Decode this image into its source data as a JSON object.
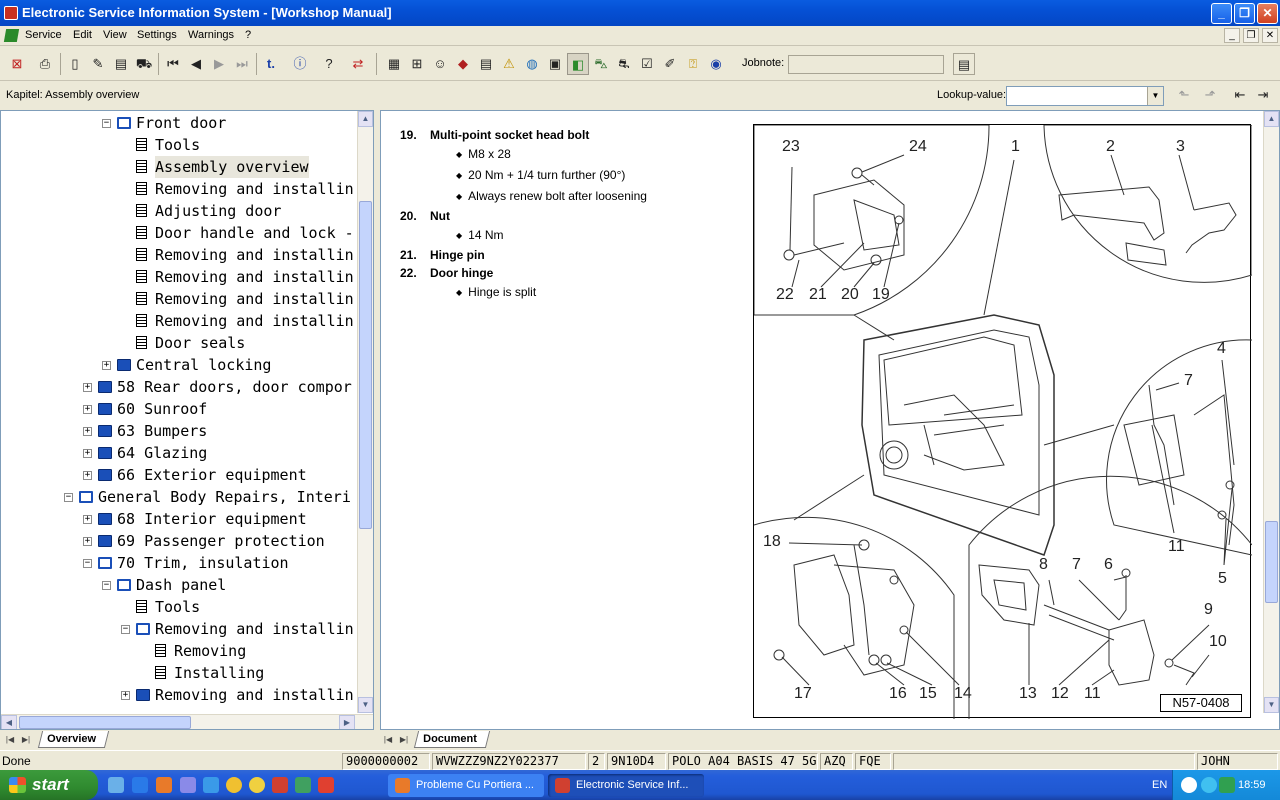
{
  "window": {
    "title": "Electronic Service Information System - [Workshop Manual]"
  },
  "menu": [
    "Service",
    "Edit",
    "View",
    "Settings",
    "Warnings",
    "?"
  ],
  "toolbar": {
    "jobnote_label": "Jobnote:",
    "jobnote_value": ""
  },
  "info": {
    "kapitel": "Kapitel: Assembly overview",
    "lookup_label": "Lookup-value:",
    "lookup_value": ""
  },
  "tree": {
    "items": [
      {
        "label": "Front door",
        "type": "book-open",
        "expander": "−",
        "level": 2
      },
      {
        "label": "Tools",
        "type": "page",
        "level": 3
      },
      {
        "label": "Assembly overview",
        "type": "page",
        "level": 3,
        "selected": true
      },
      {
        "label": "Removing and installin",
        "type": "page",
        "level": 3
      },
      {
        "label": "Adjusting door",
        "type": "page",
        "level": 3
      },
      {
        "label": "Door handle and lock -",
        "type": "page",
        "level": 3
      },
      {
        "label": "Removing and installin",
        "type": "page",
        "level": 3
      },
      {
        "label": "Removing and installin",
        "type": "page",
        "level": 3
      },
      {
        "label": "Removing and installin",
        "type": "page",
        "level": 3
      },
      {
        "label": "Removing and installin",
        "type": "page",
        "level": 3
      },
      {
        "label": "Door seals",
        "type": "page",
        "level": 3
      },
      {
        "label": "Central locking",
        "type": "book",
        "expander": "+",
        "level": 2
      },
      {
        "label": "58 Rear doors, door compor",
        "type": "book",
        "expander": "+",
        "level": 1
      },
      {
        "label": "60 Sunroof",
        "type": "book",
        "expander": "+",
        "level": 1
      },
      {
        "label": "63 Bumpers",
        "type": "book",
        "expander": "+",
        "level": 1
      },
      {
        "label": "64 Glazing",
        "type": "book",
        "expander": "+",
        "level": 1
      },
      {
        "label": "66 Exterior equipment",
        "type": "book",
        "expander": "+",
        "level": 1
      },
      {
        "label": "General Body Repairs, Interi",
        "type": "book-open",
        "expander": "−",
        "level": 0
      },
      {
        "label": "68 Interior equipment",
        "type": "book",
        "expander": "+",
        "level": 1
      },
      {
        "label": "69 Passenger protection",
        "type": "book",
        "expander": "+",
        "level": 1
      },
      {
        "label": "70 Trim, insulation",
        "type": "book-open",
        "expander": "−",
        "level": 1
      },
      {
        "label": "Dash panel",
        "type": "book-open",
        "expander": "−",
        "level": 2
      },
      {
        "label": "Tools",
        "type": "page",
        "level": 3
      },
      {
        "label": "Removing and installin",
        "type": "book-open",
        "expander": "−",
        "level": 3
      },
      {
        "label": "Removing",
        "type": "page",
        "level": 4
      },
      {
        "label": "Installing",
        "type": "page",
        "level": 4
      },
      {
        "label": "Removing and installin",
        "type": "book",
        "expander": "+",
        "level": 3
      }
    ],
    "tab": "Overview"
  },
  "document": {
    "items": [
      {
        "num": "19.",
        "title": "Multi-point socket head bolt",
        "bullets": [
          "M8 x 28",
          "20 Nm + 1/4 turn further (90°)",
          "Always renew bolt after loosening"
        ]
      },
      {
        "num": "20.",
        "title": "Nut",
        "bullets": [
          "14 Nm"
        ]
      },
      {
        "num": "21.",
        "title": "Hinge pin",
        "bullets": []
      },
      {
        "num": "22.",
        "title": "Door hinge",
        "bullets": [
          "Hinge is split"
        ]
      }
    ],
    "figure_ref": "N57-0408",
    "callouts": [
      "23",
      "24",
      "1",
      "2",
      "3",
      "22",
      "21",
      "20",
      "19",
      "4",
      "7",
      "11",
      "5",
      "18",
      "8",
      "7",
      "6",
      "9",
      "10",
      "17",
      "16",
      "15",
      "14",
      "13",
      "12",
      "11"
    ],
    "tab": "Document"
  },
  "status": {
    "text": "Done",
    "cells": [
      "9000000002",
      "WVWZZZ9NZ2Y022377",
      "2",
      "9N10D4",
      "POLO A04 BASIS 47 5G",
      "AZQ",
      "FQE",
      "",
      "JOHN"
    ]
  },
  "taskbar": {
    "start": "start",
    "tasks": [
      "Probleme Cu Portiera ...",
      "Electronic Service Inf..."
    ],
    "lang": "EN",
    "clock": "18:59"
  }
}
